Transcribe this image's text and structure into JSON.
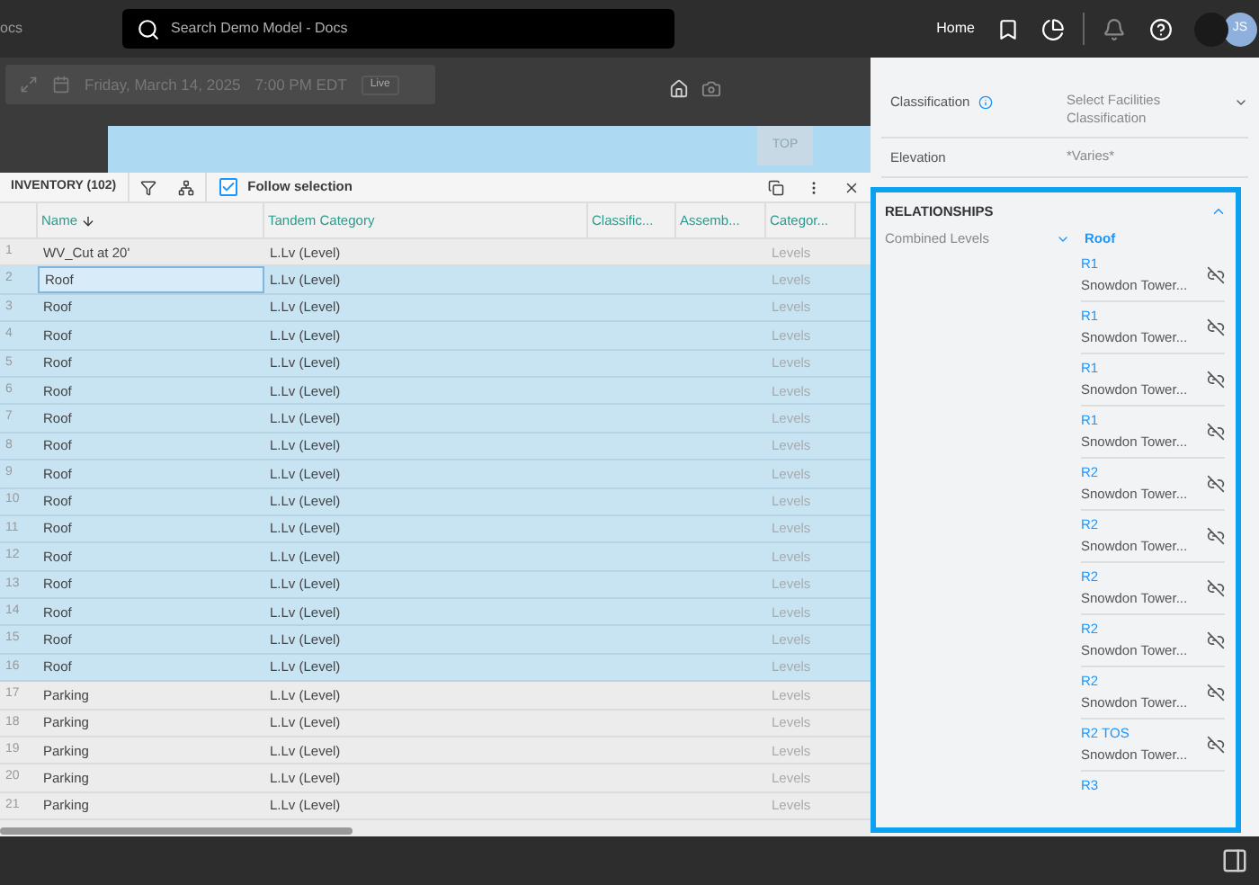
{
  "top_bar": {
    "app_title_fragment": "ocs",
    "search": {
      "placeholder": "Search Demo Model - Docs"
    },
    "home_link": "Home",
    "avatar_initials": "JS"
  },
  "viewport": {
    "date": "Friday, March 14, 2025",
    "time": "7:00 PM EDT",
    "live_badge": "Live",
    "view_cube": "TOP"
  },
  "inventory": {
    "title": "INVENTORY (102)",
    "follow_selection": {
      "label": "Follow selection",
      "checked": true
    },
    "columns": [
      {
        "label": "Name",
        "sorted": true
      },
      {
        "label": "Tandem Category",
        "sorted": false
      },
      {
        "label": "Classific...",
        "sorted": false
      },
      {
        "label": "Assemb...",
        "sorted": false
      },
      {
        "label": "Categor...",
        "sorted": false
      }
    ],
    "rows": [
      {
        "index": "1",
        "name": "WV_Cut at 20'",
        "category": "L.Lv (Level)",
        "column_5": "Levels",
        "selected": false,
        "focused": false
      },
      {
        "index": "2",
        "name": "Roof",
        "category": "L.Lv (Level)",
        "column_5": "Levels",
        "selected": true,
        "focused": true
      },
      {
        "index": "3",
        "name": "Roof",
        "category": "L.Lv (Level)",
        "column_5": "Levels",
        "selected": true,
        "focused": false
      },
      {
        "index": "4",
        "name": "Roof",
        "category": "L.Lv (Level)",
        "column_5": "Levels",
        "selected": true,
        "focused": false
      },
      {
        "index": "5",
        "name": "Roof",
        "category": "L.Lv (Level)",
        "column_5": "Levels",
        "selected": true,
        "focused": false
      },
      {
        "index": "6",
        "name": "Roof",
        "category": "L.Lv (Level)",
        "column_5": "Levels",
        "selected": true,
        "focused": false
      },
      {
        "index": "7",
        "name": "Roof",
        "category": "L.Lv (Level)",
        "column_5": "Levels",
        "selected": true,
        "focused": false
      },
      {
        "index": "8",
        "name": "Roof",
        "category": "L.Lv (Level)",
        "column_5": "Levels",
        "selected": true,
        "focused": false
      },
      {
        "index": "9",
        "name": "Roof",
        "category": "L.Lv (Level)",
        "column_5": "Levels",
        "selected": true,
        "focused": false
      },
      {
        "index": "10",
        "name": "Roof",
        "category": "L.Lv (Level)",
        "column_5": "Levels",
        "selected": true,
        "focused": false
      },
      {
        "index": "11",
        "name": "Roof",
        "category": "L.Lv (Level)",
        "column_5": "Levels",
        "selected": true,
        "focused": false
      },
      {
        "index": "12",
        "name": "Roof",
        "category": "L.Lv (Level)",
        "column_5": "Levels",
        "selected": true,
        "focused": false
      },
      {
        "index": "13",
        "name": "Roof",
        "category": "L.Lv (Level)",
        "column_5": "Levels",
        "selected": true,
        "focused": false
      },
      {
        "index": "14",
        "name": "Roof",
        "category": "L.Lv (Level)",
        "column_5": "Levels",
        "selected": true,
        "focused": false
      },
      {
        "index": "15",
        "name": "Roof",
        "category": "L.Lv (Level)",
        "column_5": "Levels",
        "selected": true,
        "focused": false
      },
      {
        "index": "16",
        "name": "Roof",
        "category": "L.Lv (Level)",
        "column_5": "Levels",
        "selected": true,
        "focused": false
      },
      {
        "index": "17",
        "name": "Parking",
        "category": "L.Lv (Level)",
        "column_5": "Levels",
        "selected": false,
        "focused": false
      },
      {
        "index": "18",
        "name": "Parking",
        "category": "L.Lv (Level)",
        "column_5": "Levels",
        "selected": false,
        "focused": false
      },
      {
        "index": "19",
        "name": "Parking",
        "category": "L.Lv (Level)",
        "column_5": "Levels",
        "selected": false,
        "focused": false
      },
      {
        "index": "20",
        "name": "Parking",
        "category": "L.Lv (Level)",
        "column_5": "Levels",
        "selected": false,
        "focused": false
      },
      {
        "index": "21",
        "name": "Parking",
        "category": "L.Lv (Level)",
        "column_5": "Levels",
        "selected": false,
        "focused": false
      }
    ]
  },
  "properties": [
    {
      "label": "Classification",
      "value": "Select Facilities Classification",
      "info": true,
      "dropdown": true
    },
    {
      "label": "Elevation",
      "value": "*Varies*",
      "info": false,
      "dropdown": false
    }
  ],
  "relationships": {
    "title": "RELATIONSHIPS",
    "expanded": true,
    "label": "Combined Levels",
    "group": "Roof",
    "items": [
      {
        "name": "R1",
        "parent": "Snowdon Tower..."
      },
      {
        "name": "R1",
        "parent": "Snowdon Tower..."
      },
      {
        "name": "R1",
        "parent": "Snowdon Tower..."
      },
      {
        "name": "R1",
        "parent": "Snowdon Tower..."
      },
      {
        "name": "R2",
        "parent": "Snowdon Tower..."
      },
      {
        "name": "R2",
        "parent": "Snowdon Tower..."
      },
      {
        "name": "R2",
        "parent": "Snowdon Tower..."
      },
      {
        "name": "R2",
        "parent": "Snowdon Tower..."
      },
      {
        "name": "R2",
        "parent": "Snowdon Tower..."
      },
      {
        "name": "R2 TOS",
        "parent": "Snowdon Tower..."
      },
      {
        "name": "R3"
      }
    ]
  }
}
